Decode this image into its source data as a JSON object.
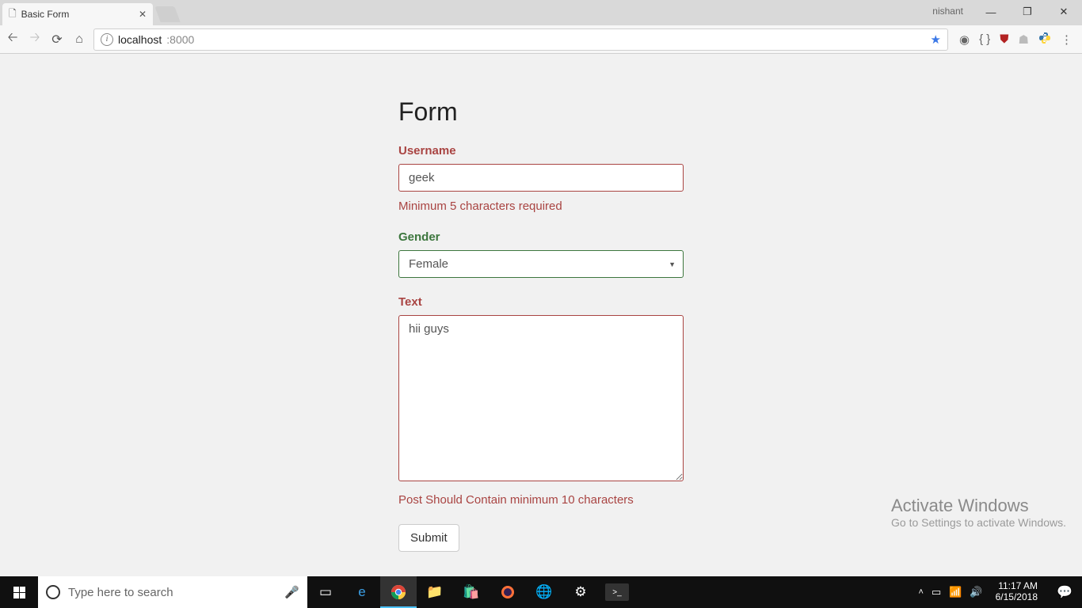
{
  "browser": {
    "tab_title": "Basic Form",
    "user_label": "nishant",
    "url_host": "localhost",
    "url_port": ":8000"
  },
  "page": {
    "heading": "Form",
    "username": {
      "label": "Username",
      "value": "geek",
      "error": "Minimum 5 characters required"
    },
    "gender": {
      "label": "Gender",
      "value": "Female"
    },
    "text": {
      "label": "Text",
      "value": "hii guys",
      "error": "Post Should Contain minimum 10 characters"
    },
    "submit_label": "Submit"
  },
  "watermark": {
    "line1": "Activate Windows",
    "line2": "Go to Settings to activate Windows."
  },
  "taskbar": {
    "search_placeholder": "Type here to search",
    "time": "11:17 AM",
    "date": "6/15/2018"
  }
}
